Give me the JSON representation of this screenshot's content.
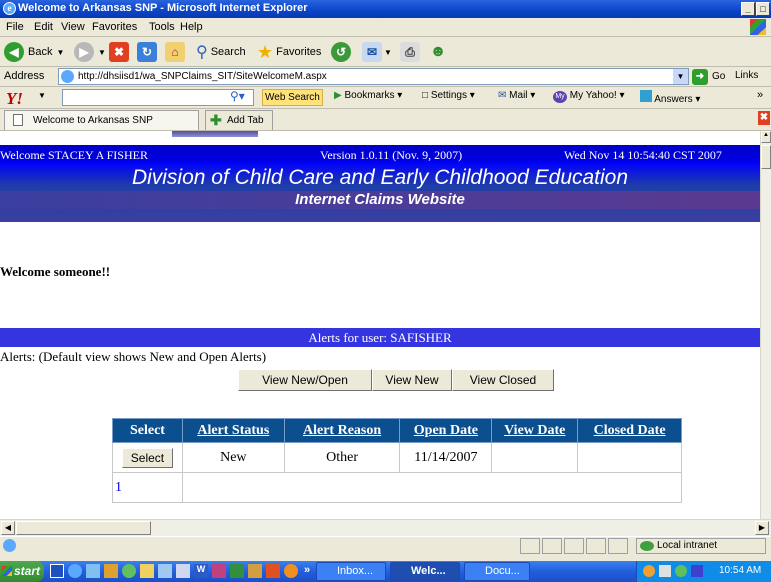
{
  "window": {
    "title": "Welcome to Arkansas SNP - Microsoft Internet Explorer",
    "min": "_",
    "max": "□"
  },
  "menu": [
    "File",
    "Edit",
    "View",
    "Favorites",
    "Tools",
    "Help"
  ],
  "toolbar": {
    "back": "Back",
    "search": "Search",
    "favorites": "Favorites"
  },
  "address": {
    "label": "Address",
    "url": "http://dhsiisd1/wa_SNPClaims_SIT/SiteWelcomeM.aspx",
    "go": "Go",
    "links": "Links"
  },
  "ybar": {
    "logo": "Y!",
    "web_search": "Web Search",
    "bookmarks": "Bookmarks",
    "settings": "Settings",
    "mail": "Mail",
    "my_yahoo": "My Yahoo!",
    "answers": "Answers"
  },
  "tabs": {
    "active": "Welcome to Arkansas SNP",
    "add": "Add Tab"
  },
  "page": {
    "welcome_user": "Welcome STACEY A FISHER",
    "version": "Version 1.0.11 (Nov. 9, 2007)",
    "datetime": "Wed Nov 14 10:54:40 CST 2007",
    "division": "Division of Child Care and Early Childhood Education",
    "site": "Internet Claims Website",
    "greeting": "Welcome someone!!",
    "alerts_header": "Alerts for user: SAFISHER",
    "alerts_note": "Alerts: (Default view shows New and Open Alerts)",
    "buttons": {
      "new_open": "View New/Open",
      "new": "View New",
      "closed": "View Closed"
    },
    "table": {
      "headers": [
        "Select",
        "Alert Status",
        "Alert Reason",
        "Open Date",
        "View Date",
        "Closed Date"
      ],
      "row": {
        "select_btn": "Select",
        "status": "New",
        "reason": "Other",
        "open_date": "11/14/2007",
        "view_date": "",
        "closed_date": ""
      },
      "pager": "1"
    }
  },
  "status": {
    "zone": "Local intranet"
  },
  "taskbar": {
    "start": "start",
    "tasks": [
      "Inbox...",
      "Welc...",
      "Docu..."
    ],
    "clock": "10:54 AM"
  },
  "colors": {
    "banner_blue": "#0000e6",
    "division_blue": "#1f3ea8",
    "table_header": "#0c4f8f",
    "alerts_bar": "#3434e0"
  }
}
